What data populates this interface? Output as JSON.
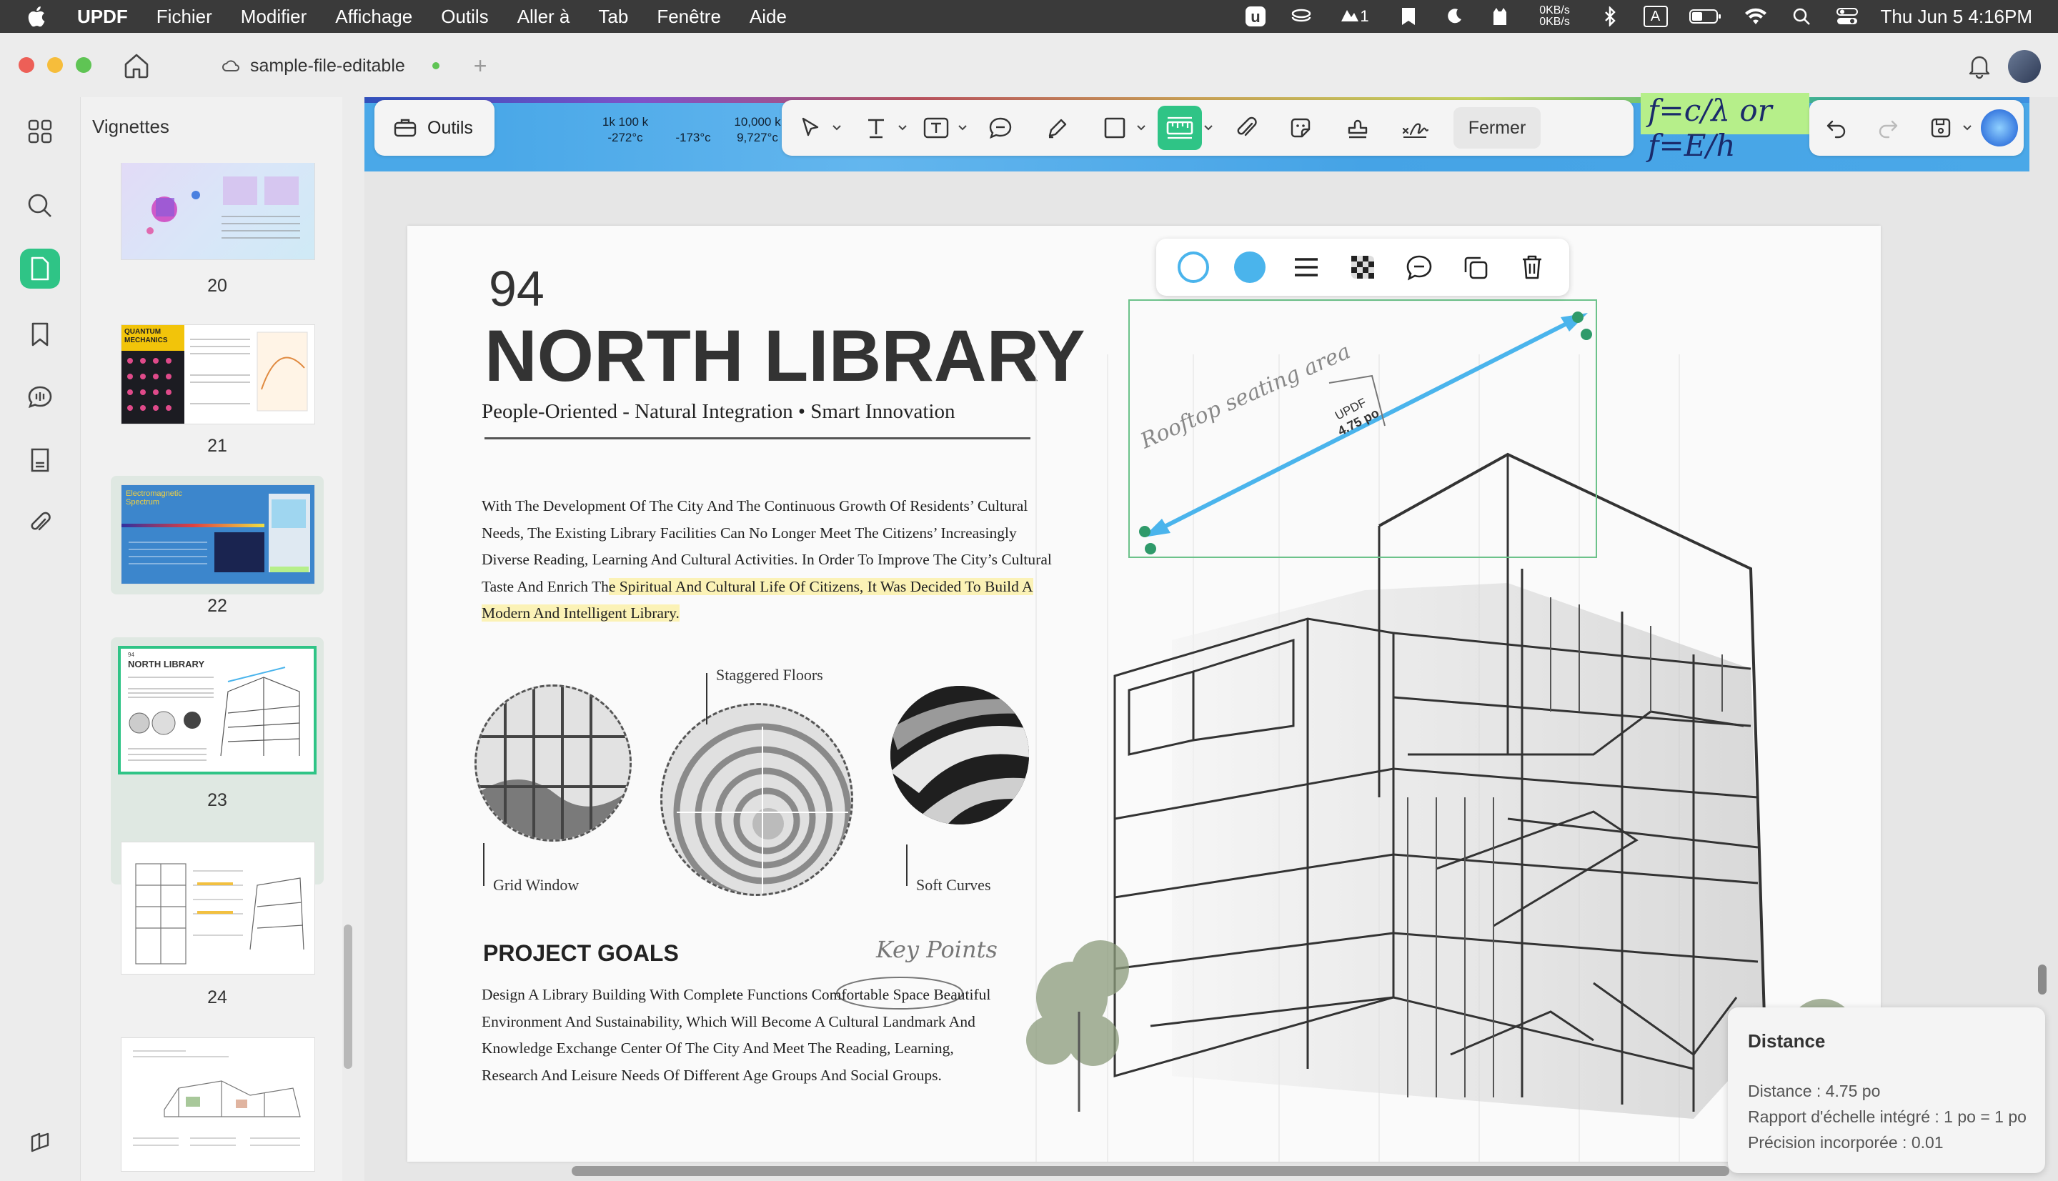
{
  "menubar": {
    "app_name": "UPDF",
    "items": [
      "Fichier",
      "Modifier",
      "Affichage",
      "Outils",
      "Aller à",
      "Tab",
      "Fenêtre",
      "Aide"
    ],
    "badge_count": "1",
    "net_up": "0KB/s",
    "net_down": "0KB/s",
    "input_source": "A",
    "clock": "Thu Jun 5  4:16PM"
  },
  "titlebar": {
    "tab_title": "sample-file-editable"
  },
  "sidebar": {
    "title": "Vignettes",
    "pages": [
      {
        "num": "20",
        "thumb_text": ""
      },
      {
        "num": "21",
        "thumb_text": "QUANTUM MECHANICS"
      },
      {
        "num": "22",
        "thumb_text": "Electromagnetic Spectrum"
      },
      {
        "num": "23",
        "thumb_text": "NORTH LIBRARY"
      },
      {
        "num": "24",
        "thumb_text": ""
      },
      {
        "num": "",
        "thumb_text": ""
      }
    ]
  },
  "toolbar": {
    "outils_label": "Outils",
    "fermer_label": "Fermer",
    "banner_scale": [
      {
        "top": "1k 100 k",
        "bottom": "-272°c"
      },
      {
        "top": "",
        "bottom": "-173°c"
      },
      {
        "top": "10,000 k",
        "bottom": "9,727°c"
      }
    ],
    "banner_formula": "f=c/λ or f=E/h"
  },
  "page": {
    "number": "94",
    "title": "NORTH LIBRARY",
    "subtitle": "People-Oriented - Natural Integration • Smart Innovation",
    "body_plain": "With The Development Of The City And The Continuous Growth Of Residents’ Cultural Needs, The Existing Library Facilities Can No Longer Meet The Citizens’ Increasingly Diverse Reading, Learning And Cultural Activities. In Order To Improve The City’s Cultural Taste And Enrich Th",
    "body_highlight": "e Spiritual And Cultural Life Of Citizens, It Was Decided To Build A Modern And Intelligent Library.",
    "caption_staggered": "Staggered Floors",
    "caption_grid": "Grid Window",
    "caption_soft": "Soft Curves",
    "goals_title": "PROJECT GOALS",
    "goals_text": "Design A Library Building With Complete Functions Comfortable Space Beautiful Environment And Sustainability, Which Will Become A Cultural Landmark And Knowledge Exchange Center Of The City And Meet The Reading, Learning, Research And Leisure Needs Of Different Age Groups And Social Groups.",
    "key_points": "Key Points",
    "rooftop_label": "Rooftop seating area",
    "measure_label_top": "UPDF",
    "measure_label_value": "4.75 po"
  },
  "distance_panel": {
    "title": "Distance",
    "distance": "Distance : 4.75 po",
    "scale": "Rapport d'échelle intégré : 1 po = 1 po",
    "precision": "Précision incorporée : 0.01"
  },
  "colors": {
    "accent": "#2fc486",
    "measure_line": "#4ab4ec",
    "highlight": "#fbf2b6"
  }
}
